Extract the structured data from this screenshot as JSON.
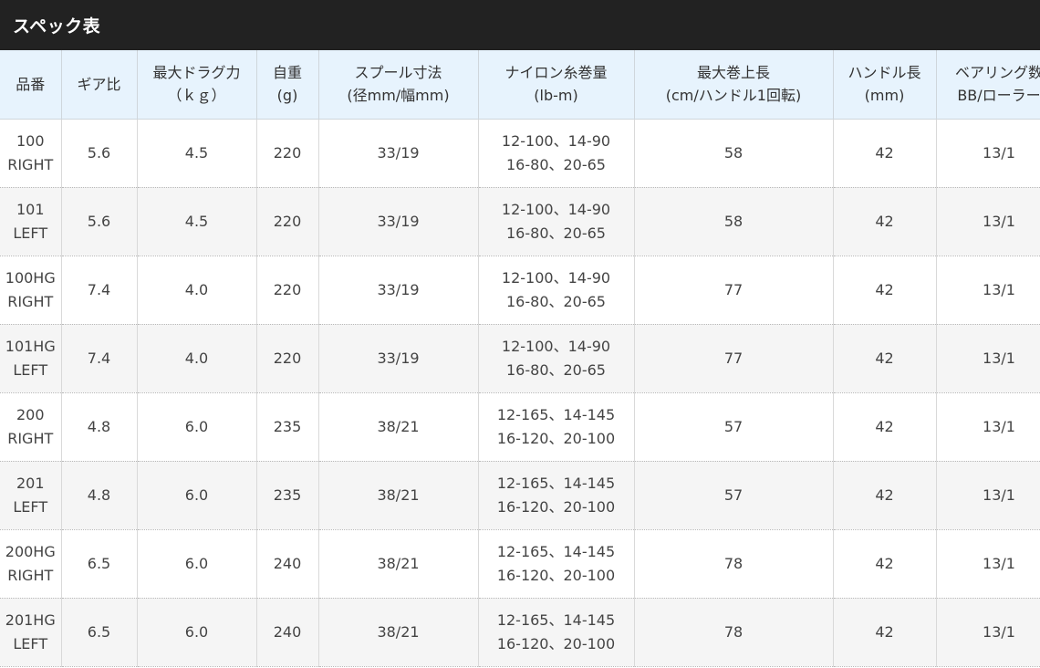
{
  "title": "スペック表",
  "headers": [
    [
      "品番"
    ],
    [
      "ギア比"
    ],
    [
      "最大ドラグ力",
      "（ｋｇ）"
    ],
    [
      "自重",
      "(g)"
    ],
    [
      "スプール寸法",
      "(径mm/幅mm)"
    ],
    [
      "ナイロン糸巻量",
      "(lb-m)"
    ],
    [
      "最大巻上長",
      "(cm/ハンドル1回転)"
    ],
    [
      "ハンドル長",
      "(mm)"
    ],
    [
      "ベアリング数",
      "BB/ローラー"
    ]
  ],
  "rows": [
    {
      "model": [
        "100",
        "RIGHT"
      ],
      "gear": "5.6",
      "drag": "4.5",
      "weight": "220",
      "spool": "33/19",
      "line": [
        "12-100、14-90",
        "16-80、20-65"
      ],
      "retrieve": "58",
      "handle": "42",
      "bearing": "13/1"
    },
    {
      "model": [
        "101",
        "LEFT"
      ],
      "gear": "5.6",
      "drag": "4.5",
      "weight": "220",
      "spool": "33/19",
      "line": [
        "12-100、14-90",
        "16-80、20-65"
      ],
      "retrieve": "58",
      "handle": "42",
      "bearing": "13/1"
    },
    {
      "model": [
        "100HG",
        "RIGHT"
      ],
      "gear": "7.4",
      "drag": "4.0",
      "weight": "220",
      "spool": "33/19",
      "line": [
        "12-100、14-90",
        "16-80、20-65"
      ],
      "retrieve": "77",
      "handle": "42",
      "bearing": "13/1"
    },
    {
      "model": [
        "101HG",
        "LEFT"
      ],
      "gear": "7.4",
      "drag": "4.0",
      "weight": "220",
      "spool": "33/19",
      "line": [
        "12-100、14-90",
        "16-80、20-65"
      ],
      "retrieve": "77",
      "handle": "42",
      "bearing": "13/1"
    },
    {
      "model": [
        "200",
        "RIGHT"
      ],
      "gear": "4.8",
      "drag": "6.0",
      "weight": "235",
      "spool": "38/21",
      "line": [
        "12-165、14-145",
        "16-120、20-100"
      ],
      "retrieve": "57",
      "handle": "42",
      "bearing": "13/1"
    },
    {
      "model": [
        "201",
        "LEFT"
      ],
      "gear": "4.8",
      "drag": "6.0",
      "weight": "235",
      "spool": "38/21",
      "line": [
        "12-165、14-145",
        "16-120、20-100"
      ],
      "retrieve": "57",
      "handle": "42",
      "bearing": "13/1"
    },
    {
      "model": [
        "200HG",
        "RIGHT"
      ],
      "gear": "6.5",
      "drag": "6.0",
      "weight": "240",
      "spool": "38/21",
      "line": [
        "12-165、14-145",
        "16-120、20-100"
      ],
      "retrieve": "78",
      "handle": "42",
      "bearing": "13/1"
    },
    {
      "model": [
        "201HG",
        "LEFT"
      ],
      "gear": "6.5",
      "drag": "6.0",
      "weight": "240",
      "spool": "38/21",
      "line": [
        "12-165、14-145",
        "16-120、20-100"
      ],
      "retrieve": "78",
      "handle": "42",
      "bearing": "13/1"
    }
  ]
}
